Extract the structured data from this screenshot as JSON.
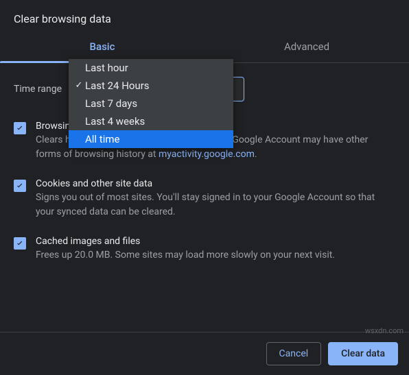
{
  "title": "Clear browsing data",
  "tabs": {
    "basic": "Basic",
    "advanced": "Advanced"
  },
  "time_range": {
    "label": "Time range",
    "options": [
      "Last hour",
      "Last 24 Hours",
      "Last 7 days",
      "Last 4 weeks",
      "All time"
    ],
    "selected": "Last 24 Hours",
    "highlighted": "All time"
  },
  "options": {
    "browsing": {
      "title": "Browsing history",
      "desc_prefix": "Clears history from all signed-in devices. Your Google Account may have other forms of browsing history at ",
      "link": "myactivity.google.com",
      "desc_suffix": ".",
      "checked": true
    },
    "cookies": {
      "title": "Cookies and other site data",
      "desc": "Signs you out of most sites. You'll stay signed in to your Google Account so that your synced data can be cleared.",
      "checked": true
    },
    "cache": {
      "title": "Cached images and files",
      "desc": "Frees up 20.0 MB. Some sites may load more slowly on your next visit.",
      "checked": true
    }
  },
  "buttons": {
    "cancel": "Cancel",
    "clear": "Clear data"
  },
  "watermark": "wsxdn.com"
}
